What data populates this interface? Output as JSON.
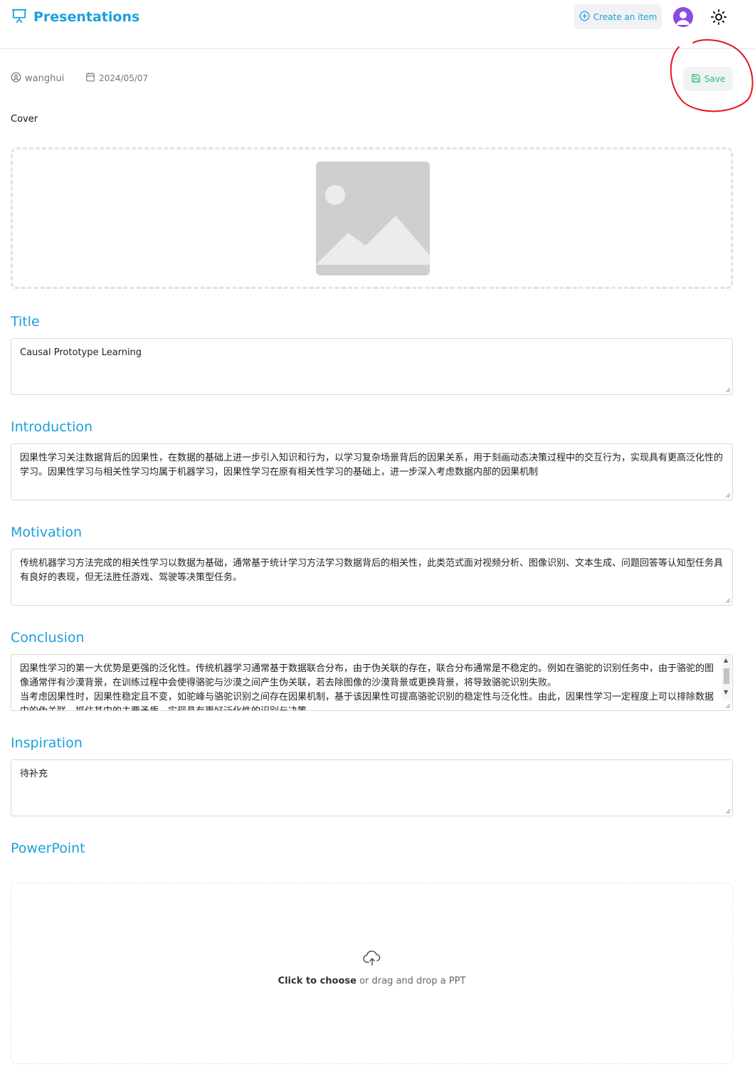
{
  "header": {
    "app_title": "Presentations",
    "logo_icon": "presentation-icon",
    "create_button_label": "Create an item",
    "create_icon": "plus-circle-icon",
    "theme_icon": "sun-icon",
    "brand_color": "#1b9fdc"
  },
  "meta": {
    "author": "wanghui",
    "author_icon": "user-circle-icon",
    "date": "2024/05/07",
    "date_icon": "calendar-icon",
    "save_label": "Save",
    "save_icon": "save-icon",
    "save_color": "#2fbf71"
  },
  "cover": {
    "label": "Cover",
    "placeholder_icon": "image-placeholder-icon"
  },
  "sections": {
    "title": {
      "heading": "Title",
      "value": "Causal Prototype Learning"
    },
    "introduction": {
      "heading": "Introduction",
      "value": "因果性学习关注数据背后的因果性，在数据的基础上进一步引入知识和行为，以学习复杂场景背后的因果关系，用于刻画动态决策过程中的交互行为，实现具有更高泛化性的学习。因果性学习与相关性学习均属于机器学习，因果性学习在原有相关性学习的基础上，进一步深入考虑数据内部的因果机制"
    },
    "motivation": {
      "heading": "Motivation",
      "value": "传统机器学习方法完成的相关性学习以数据为基础，通常基于统计学习方法学习数据背后的相关性，此类范式面对视频分析、图像识别、文本生成、问题回答等认知型任务具有良好的表现，但无法胜任游戏、驾驶等决策型任务。"
    },
    "conclusion": {
      "heading": "Conclusion",
      "value": "因果性学习的第一大优势是更强的泛化性。传统机器学习通常基于数据联合分布，由于伪关联的存在，联合分布通常是不稳定的。例如在骆驼的识别任务中，由于骆驼的图像通常伴有沙漠背景，在训练过程中会使得骆驼与沙漠之间产生伪关联，若去除图像的沙漠背景或更换背景，将导致骆驼识别失败。\n当考虑因果性时，因果性稳定且不变，如驼峰与骆驼识别之间存在因果机制，基于该因果性可提高骆驼识别的稳定性与泛化性。由此，因果性学习一定程度上可以排除数据中的伪关联，抓住其中的主要矛盾，实现具有更好泛化性的识别与决策。"
    },
    "inspiration": {
      "heading": "Inspiration",
      "value": "待补充"
    }
  },
  "powerpoint": {
    "heading": "PowerPoint",
    "upload_icon": "cloud-upload-icon",
    "upload_strong": "Click to choose",
    "upload_rest": " or drag and drop a PPT"
  }
}
